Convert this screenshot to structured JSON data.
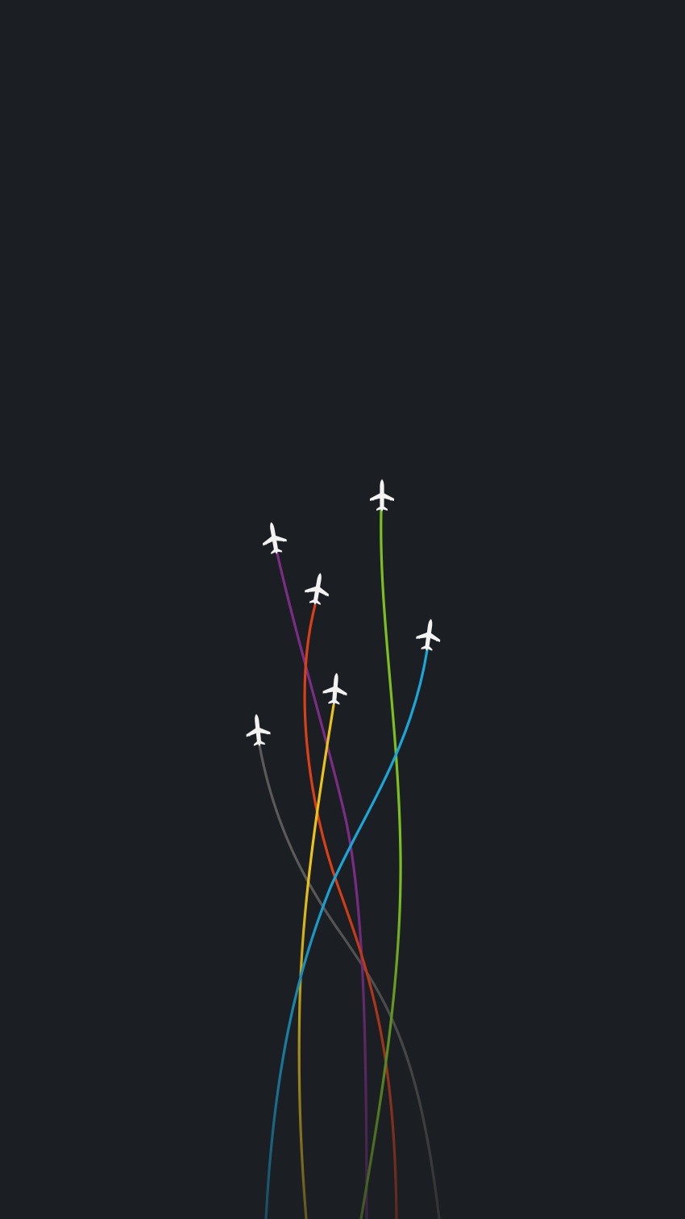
{
  "background_color": "#1b1e22",
  "plane_icon": "airplane-icon",
  "plane_color": "#f2f2f2",
  "flights": [
    {
      "name": "gray",
      "color": "#5a5a5a"
    },
    {
      "name": "purple",
      "color": "#7b2d86"
    },
    {
      "name": "red",
      "color": "#d8401a"
    },
    {
      "name": "yellow",
      "color": "#e9c21b"
    },
    {
      "name": "green",
      "color": "#7cbf22"
    },
    {
      "name": "blue",
      "color": "#1aa6d8"
    }
  ]
}
